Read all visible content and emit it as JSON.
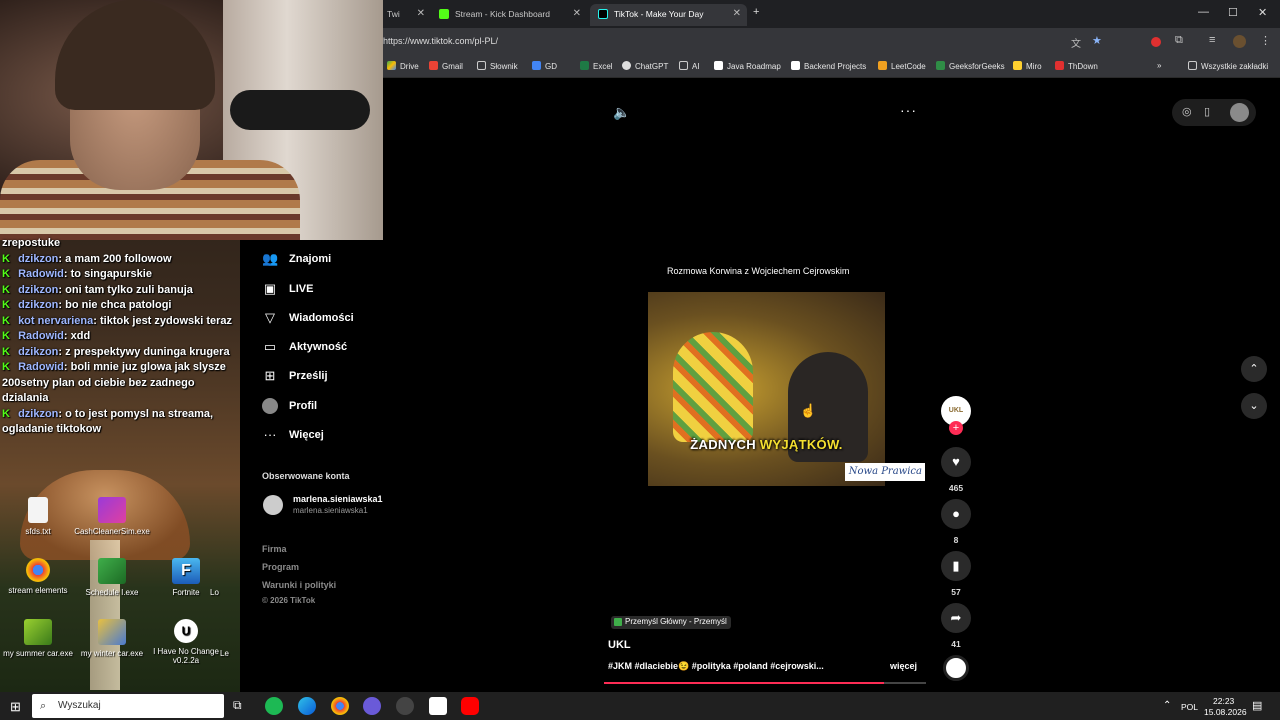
{
  "colors": {
    "kick_green": "#53fc18",
    "tiktok_red": "#fe2c55",
    "chat_name": "#9fb7ff"
  },
  "chat": {
    "fragment_top": "zrepostuke",
    "lines": [
      {
        "user": "dzikzon",
        "message": "a mam 200 followow"
      },
      {
        "user": "Radowid",
        "message": "to singapurskie"
      },
      {
        "user": "dzikzon",
        "message": "oni tam tylko zuli banuja"
      },
      {
        "user": "dzikzon",
        "message": "bo nie chca patologi"
      },
      {
        "user": "kot nervariena",
        "message": "tiktok jest zydowski teraz"
      },
      {
        "user": "Radowid",
        "message": "xdd"
      },
      {
        "user": "dzikzon",
        "message": "z prespektywy duninga krugera"
      },
      {
        "user": "Radowid",
        "message": "boli mnie juz glowa jak slysze 200setny plan od ciebie bez zadnego dzialania"
      },
      {
        "user": "dzikzon",
        "message": "o to jest pomysl na streama, ogladanie tiktokow"
      }
    ]
  },
  "desktop_icons": [
    {
      "label": "sfds.txt",
      "icon": "text-file-icon"
    },
    {
      "label": "CashCleanerSim.exe",
      "icon": "exe-icon"
    },
    {
      "label": "stream elements",
      "icon": "chrome-icon"
    },
    {
      "label": "Schedule I.exe",
      "icon": "exe-icon"
    },
    {
      "label": "Fortnite",
      "icon": "fortnite-icon"
    },
    {
      "label": "Lo",
      "icon": "exe-icon"
    },
    {
      "label": "my summer car.exe",
      "icon": "exe-icon"
    },
    {
      "label": "my winter car.exe",
      "icon": "exe-icon"
    },
    {
      "label": "I Have No Change v0.2.2a",
      "icon": "unreal-icon"
    },
    {
      "label": "Le",
      "icon": "exe-icon"
    }
  ],
  "browser": {
    "tabs": [
      {
        "label": "Twi",
        "active": false
      },
      {
        "label": "Stream - Kick Dashboard",
        "active": false
      },
      {
        "label": "TikTok - Make Your Day",
        "active": true
      }
    ],
    "new_tab": "+",
    "url": "https://www.tiktok.com/pl-PL/",
    "bookmarks": [
      "Drive",
      "Gmail",
      "Słownik",
      "GD",
      "Excel",
      "ChatGPT",
      "AI",
      "Java Roadmap",
      "Backend Projects",
      "LeetCode",
      "GeeksforGeeks",
      "Miro",
      "ThDown"
    ],
    "all_bookmarks": "Wszystkie zakładki",
    "more_bookmarks": "»"
  },
  "tiktok": {
    "nav": [
      "Znajomi",
      "LIVE",
      "Wiadomości",
      "Aktywność",
      "Prześlij",
      "Profil",
      "Więcej"
    ],
    "followed_title": "Obserwowane konta",
    "followed": {
      "name": "marlena.sieniawska1",
      "handle": "marlena.sieniawska1"
    },
    "footer": [
      "Firma",
      "Program",
      "Warunki i polityki",
      "© 2026 TikTok"
    ],
    "video": {
      "title": "Rozmowa Korwina  z Wojciechem Cejrowskim",
      "caption_white": "ŻADNYCH",
      "caption_yellow": "WYJĄTKÓW.",
      "watermark": "Nowa Prawica",
      "progress": 0.87
    },
    "actions": {
      "likes": "465",
      "comments": "8",
      "saves": "57",
      "shares": "41"
    },
    "author_badge": "UKL",
    "music": "Przemyśl Główny - Przemyśl",
    "author": "UKL",
    "description": "#JKM #dlaciebie😉 #polityka #poland #cejrowski...",
    "more": "więcej"
  },
  "taskbar": {
    "search_placeholder": "Wyszukaj",
    "lang": "POL",
    "time": "22:23",
    "date": "15.08.2026"
  }
}
